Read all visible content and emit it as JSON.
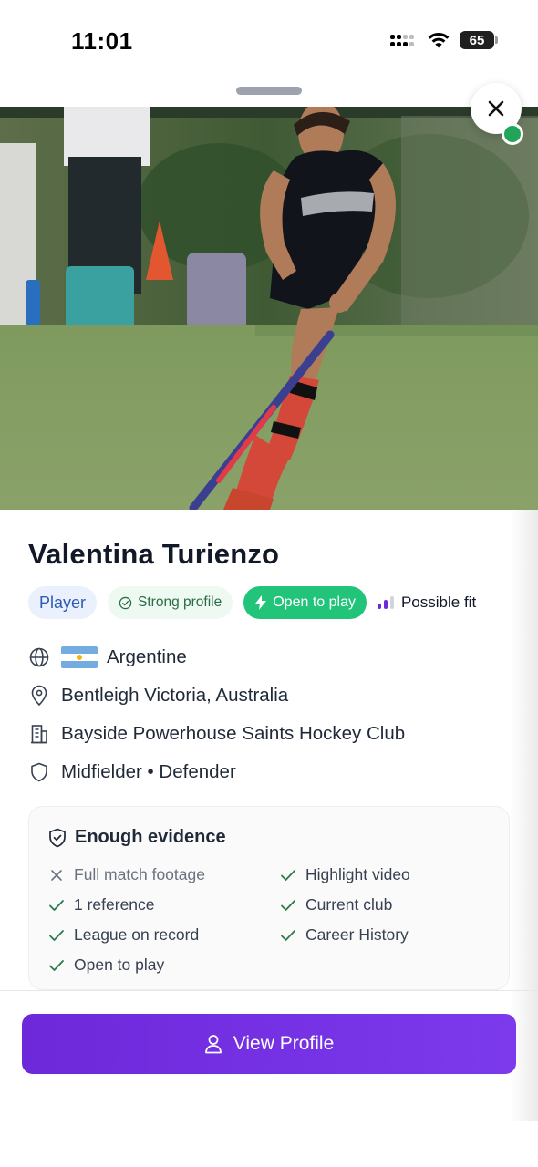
{
  "status_bar": {
    "time": "11:01",
    "battery": "65"
  },
  "colors": {
    "accent": "#7c3aed",
    "success": "#22c47a",
    "tag_blue": "#2f5bb5"
  },
  "hero": {
    "image": "field-hockey-player-photo"
  },
  "profile": {
    "name": "Valentina Turienzo",
    "tags": {
      "role": "Player",
      "profile_strength": "Strong profile",
      "availability": "Open to play",
      "fit": "Possible fit"
    },
    "nationality": "Argentine",
    "location": "Bentleigh Victoria, Australia",
    "club": "Bayside Powerhouse Saints Hockey Club",
    "positions": "Midfielder • Defender"
  },
  "evidence": {
    "title": "Enough evidence",
    "items": [
      {
        "label": "Full match footage",
        "status": "missing"
      },
      {
        "label": "Highlight video",
        "status": "present"
      },
      {
        "label": "1 reference",
        "status": "present"
      },
      {
        "label": "Current club",
        "status": "present"
      },
      {
        "label": "League on record",
        "status": "present"
      },
      {
        "label": "Career History",
        "status": "present"
      },
      {
        "label": "Open to play",
        "status": "present"
      }
    ]
  },
  "actions": {
    "view_profile": "View Profile"
  }
}
